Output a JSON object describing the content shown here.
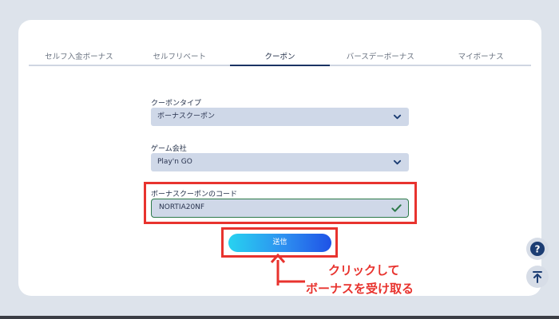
{
  "tabs": [
    {
      "label": "セルフ入金ボーナス",
      "active": false
    },
    {
      "label": "セルフリベート",
      "active": false
    },
    {
      "label": "クーポン",
      "active": true
    },
    {
      "label": "バースデーボーナス",
      "active": false
    },
    {
      "label": "マイボーナス",
      "active": false
    }
  ],
  "form": {
    "coupon_type_label": "クーポンタイプ",
    "coupon_type_value": "ボーナスクーポン",
    "game_company_label": "ゲーム会社",
    "game_company_value": "Play'n GO",
    "coupon_code_label": "ボーナスクーポンのコード",
    "coupon_code_value": "NORTIA20NF",
    "submit_label": "送信"
  },
  "annotation": {
    "line1": "クリックして",
    "line2": "ボーナスを受け取る"
  },
  "icons": {
    "help": "question-icon",
    "scroll_top": "arrow-up-to-top-icon",
    "valid": "checkmark-icon",
    "select": "chevron-down-icon"
  },
  "colors": {
    "accent_red": "#e8332e",
    "navy": "#1c3d73",
    "valid_green": "#2d7a4a"
  }
}
